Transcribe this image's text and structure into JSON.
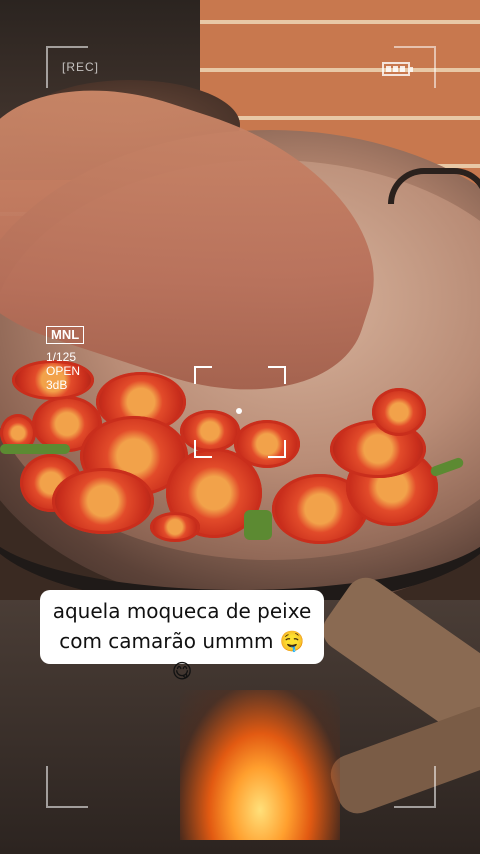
{
  "overlay": {
    "rec_label": "[REC]",
    "mode_badge": "MNL",
    "shutter": "1/125",
    "aperture": "OPEN",
    "gain": "3dB"
  },
  "caption": {
    "line1": "aquela moqueca de peixe",
    "line2": "com camarão ummm 🤤😋"
  }
}
